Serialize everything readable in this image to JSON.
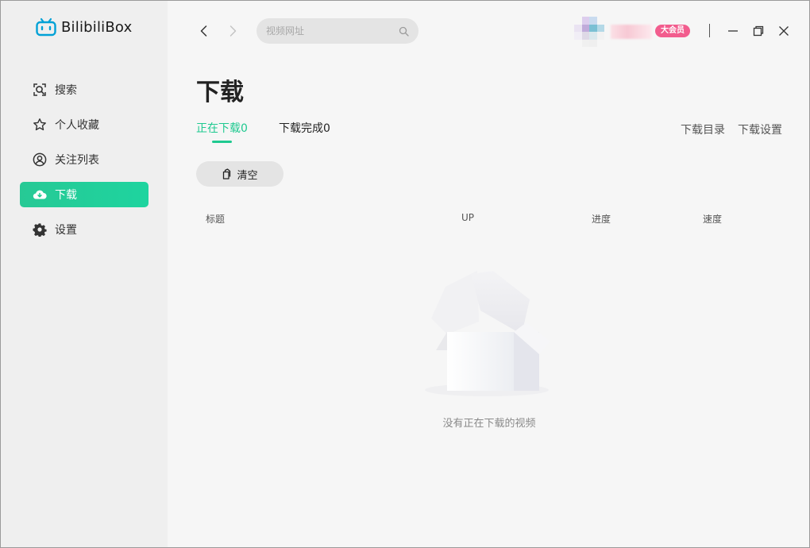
{
  "app": {
    "name": "BilibiliBox",
    "brand_color": "#00a1d6",
    "accent": "#1fc990"
  },
  "sidebar": {
    "items": [
      {
        "label": "搜索",
        "icon": "search-icon",
        "active": false
      },
      {
        "label": "个人收藏",
        "icon": "star-icon",
        "active": false
      },
      {
        "label": "关注列表",
        "icon": "user-circle-icon",
        "active": false
      },
      {
        "label": "下载",
        "icon": "cloud-download-icon",
        "active": true
      },
      {
        "label": "设置",
        "icon": "gear-icon",
        "active": false
      }
    ]
  },
  "topbar": {
    "search_placeholder": "视频网址",
    "vip_badge": "大会员"
  },
  "main": {
    "title": "下载",
    "tabs": [
      {
        "label": "正在下载0",
        "active": true
      },
      {
        "label": "下载完成0",
        "active": false
      }
    ],
    "links": {
      "download_dir": "下载目录",
      "download_settings": "下载设置"
    },
    "clear_button": "清空",
    "columns": [
      "标题",
      "UP",
      "进度",
      "速度"
    ],
    "empty_text": "没有正在下载的视频"
  }
}
